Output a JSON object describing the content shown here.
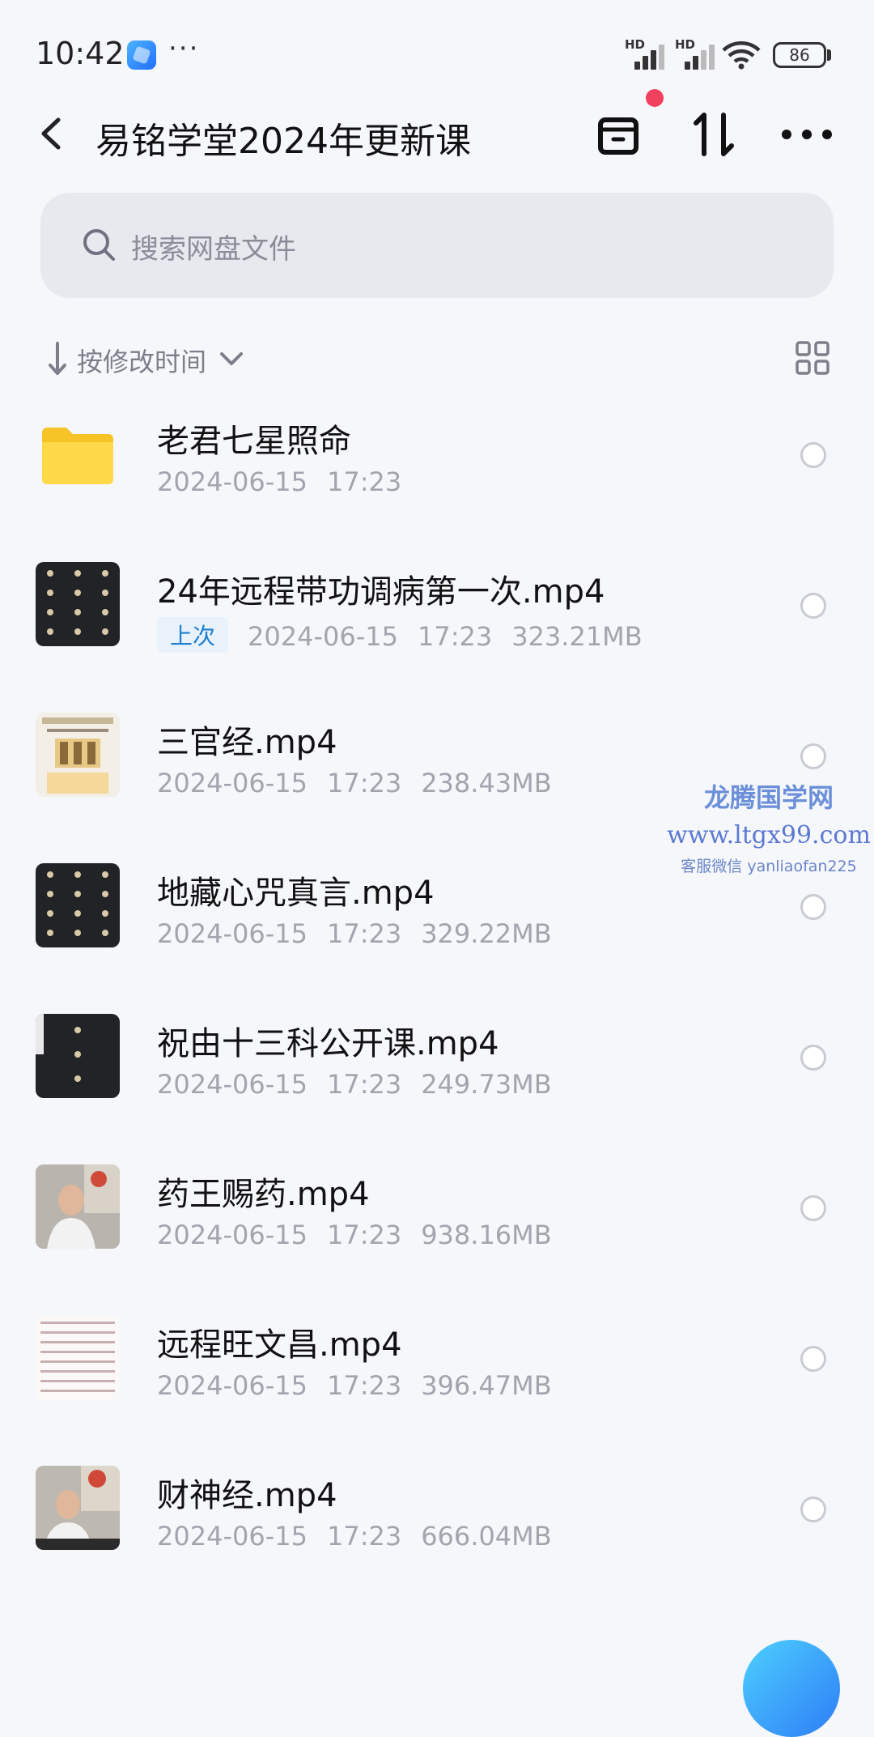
{
  "status_bar": {
    "time": "10:42",
    "dots": "···",
    "signal1_label": "HD",
    "signal2_label": "HD",
    "battery": "86"
  },
  "header": {
    "title": "易铭学堂2024年更新课"
  },
  "search": {
    "placeholder": "搜索网盘文件"
  },
  "sort": {
    "label": "按修改时间"
  },
  "files": [
    {
      "name": "老君七星照命",
      "date": "2024-06-15",
      "time": "17:23",
      "size": "",
      "tag": "",
      "kind": "folder"
    },
    {
      "name": "24年远程带功调病第一次.mp4",
      "date": "2024-06-15",
      "time": "17:23",
      "size": "323.21MB",
      "tag": "上次",
      "kind": "video-dark"
    },
    {
      "name": "三官经.mp4",
      "date": "2024-06-15",
      "time": "17:23",
      "size": "238.43MB",
      "tag": "",
      "kind": "video-light"
    },
    {
      "name": "地藏心咒真言.mp4",
      "date": "2024-06-15",
      "time": "17:23",
      "size": "329.22MB",
      "tag": "",
      "kind": "video-dark"
    },
    {
      "name": "祝由十三科公开课.mp4",
      "date": "2024-06-15",
      "time": "17:23",
      "size": "249.73MB",
      "tag": "",
      "kind": "video-dark"
    },
    {
      "name": "药王赐药.mp4",
      "date": "2024-06-15",
      "time": "17:23",
      "size": "938.16MB",
      "tag": "",
      "kind": "video-person"
    },
    {
      "name": "远程旺文昌.mp4",
      "date": "2024-06-15",
      "time": "17:23",
      "size": "396.47MB",
      "tag": "",
      "kind": "video-text"
    },
    {
      "name": "财神经.mp4",
      "date": "2024-06-15",
      "time": "17:23",
      "size": "666.04MB",
      "tag": "",
      "kind": "video-person"
    }
  ],
  "watermark": {
    "line1": "龙腾国学网",
    "line2": "www.ltgx99.com",
    "line3": "客服微信 yanliaofan225"
  },
  "colors": {
    "accent": "#1d7fd0",
    "notification_dot": "#f2415f",
    "background": "#f6f7fb"
  }
}
